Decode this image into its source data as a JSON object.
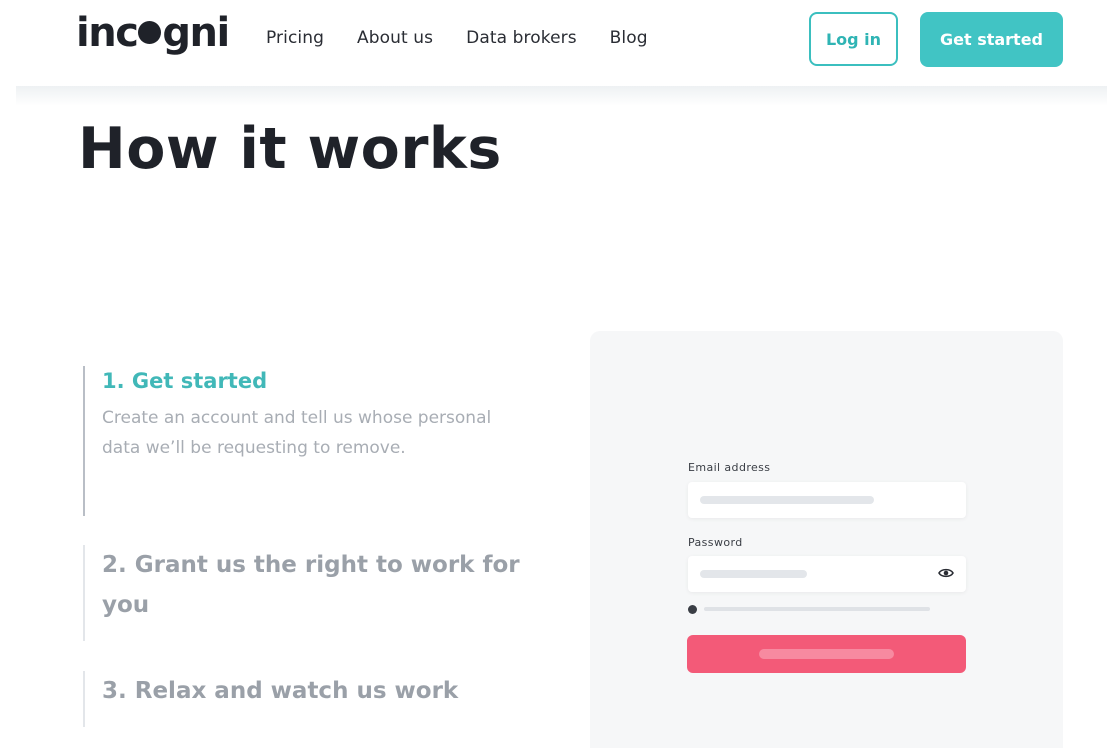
{
  "header": {
    "logo": {
      "before": "inc",
      "after": "gni"
    },
    "nav": [
      "Pricing",
      "About us",
      "Data brokers",
      "Blog"
    ],
    "login_label": "Log in",
    "get_started_label": "Get started"
  },
  "page_title": "How it works",
  "steps": [
    {
      "title": "1. Get started",
      "description": "Create an account and tell us whose personal data we’ll be requesting to remove.",
      "active": true
    },
    {
      "title": "2. Grant us the right to work for you",
      "active": false
    },
    {
      "title": "3. Relax and watch us work",
      "active": false
    }
  ],
  "form_illustration": {
    "email_label": "Email address",
    "password_label": "Password",
    "password_toggle_icon": "eye-icon",
    "strength_info_icon": "info-dot-icon"
  },
  "colors": {
    "accent": "#41c4c4",
    "step_active": "#41b8b8",
    "submit": "#f35a78"
  }
}
